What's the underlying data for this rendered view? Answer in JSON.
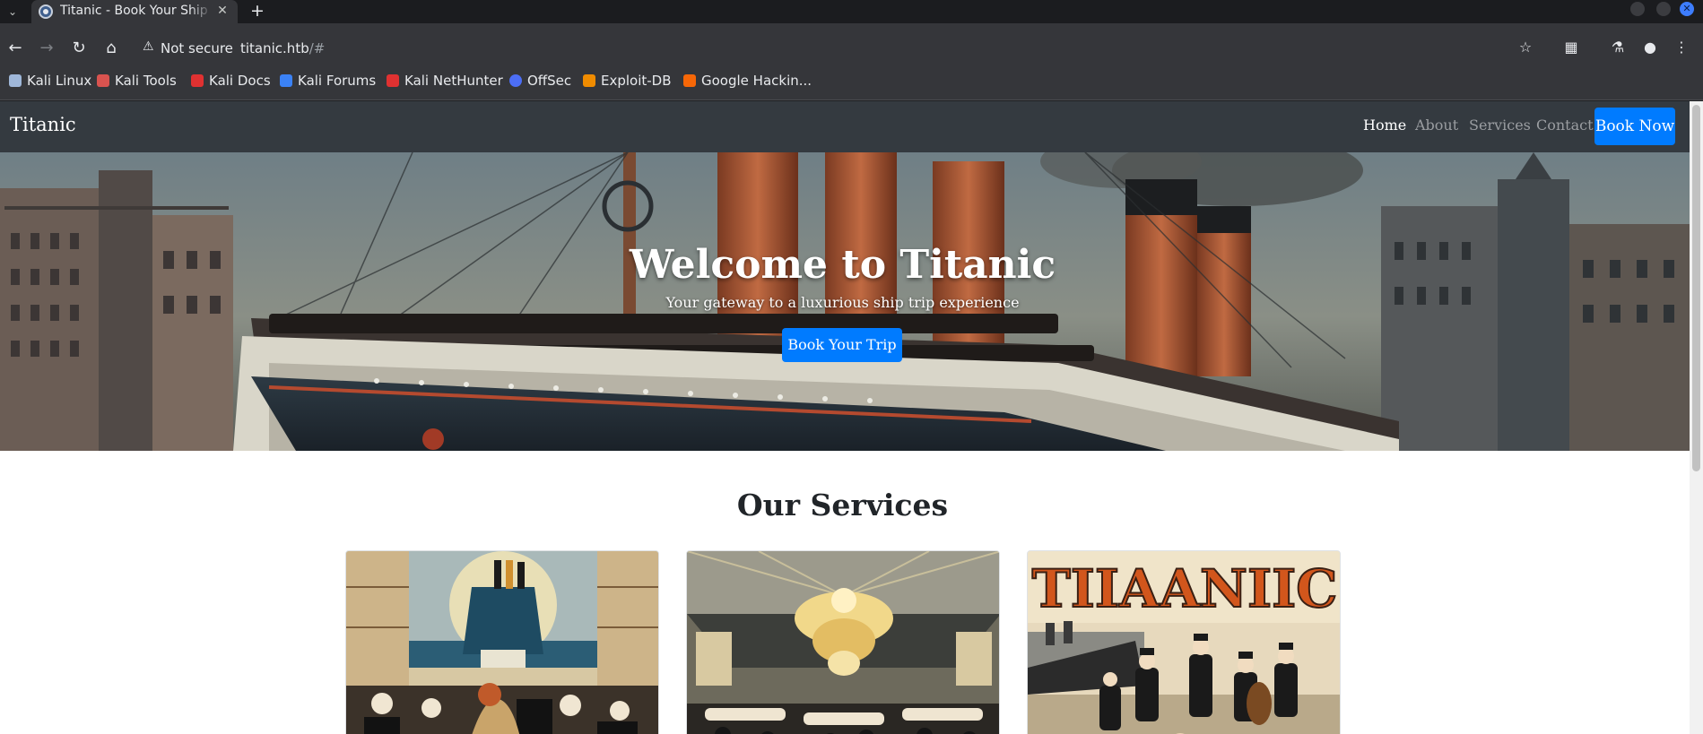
{
  "browser": {
    "tab_title": "Titanic - Book Your Ship Trip",
    "new_tab_label": "+",
    "security_label": "Not secure",
    "url_host": "titanic.htb",
    "url_path": "/#",
    "bookmarks": [
      {
        "label": "Kali Linux",
        "icon": "kali-dragon-icon",
        "color": "#9fb7d9"
      },
      {
        "label": "Kali Tools",
        "icon": "kali-tools-icon",
        "color": "#d9534f"
      },
      {
        "label": "Kali Docs",
        "icon": "kali-docs-icon",
        "color": "#e03131"
      },
      {
        "label": "Kali Forums",
        "icon": "kali-forums-icon",
        "color": "#3b82f6"
      },
      {
        "label": "Kali NetHunter",
        "icon": "nethunter-icon",
        "color": "#e03131"
      },
      {
        "label": "OffSec",
        "icon": "offsec-icon",
        "color": "#4c6ef5"
      },
      {
        "label": "Exploit-DB",
        "icon": "exploit-db-icon",
        "color": "#f08c00"
      },
      {
        "label": "Google Hackin...",
        "icon": "ghdb-icon",
        "color": "#f76707"
      }
    ]
  },
  "site": {
    "brand": "Titanic",
    "nav": {
      "home": "Home",
      "about": "About",
      "services": "Services",
      "contact": "Contact",
      "book_now": "Book Now"
    },
    "hero": {
      "title": "Welcome to Titanic",
      "subtitle": "Your gateway to a luxurious ship trip experience",
      "cta": "Book Your Trip"
    },
    "services": {
      "title": "Our Services",
      "cards": [
        {
          "image": "ballroom-dancing-image"
        },
        {
          "image": "grand-chandelier-hall-image"
        },
        {
          "image": "titanic-entertainment-poster-image",
          "poster_text": "TIIAANIIC"
        }
      ]
    }
  },
  "colors": {
    "accent": "#007bff",
    "navbar": "#343a40",
    "nav_inactive": "#9a9da1"
  }
}
